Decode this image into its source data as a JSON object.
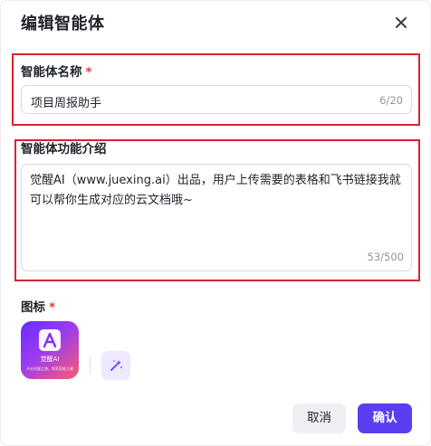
{
  "dialog": {
    "title": "编辑智能体",
    "close_icon": "close-icon"
  },
  "name_field": {
    "label": "智能体名称",
    "required_mark": "*",
    "value": "项目周报助手",
    "counter": "6/20"
  },
  "description_field": {
    "label": "智能体功能介绍",
    "value": "觉醒AI（www.juexing.ai）出品，用户上传需要的表格和飞书链接我就可以帮你生成对应的云文档哦~",
    "counter": "53/500"
  },
  "icon_field": {
    "label": "图标",
    "required_mark": "*",
    "app_icon_brand": "觉醒AI",
    "app_icon_tagline": "开启觉醒之旅，探索智能之美",
    "generate_icon": "sparkle-icon"
  },
  "footer": {
    "cancel_label": "取消",
    "confirm_label": "确认"
  },
  "colors": {
    "primary": "#5b3df2",
    "highlight_border": "#d9232e",
    "required": "#e53935"
  }
}
